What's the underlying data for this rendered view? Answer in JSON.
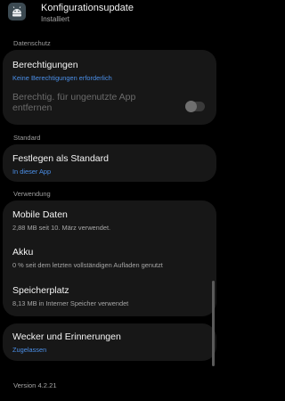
{
  "header": {
    "app_name": "Konfigurationsupdate",
    "status": "Installiert",
    "icon": "android-icon"
  },
  "sections": {
    "datenschutz": "Datenschutz",
    "standard": "Standard",
    "verwendung": "Verwendung"
  },
  "items": {
    "berechtigungen": {
      "title": "Berechtigungen",
      "subtitle": "Keine Berechtigungen erforderlich"
    },
    "unused_permissions": {
      "title": "Berechtig. für ungenutzte App entfernen",
      "toggle_on": false
    },
    "standard": {
      "title": "Festlegen als Standard",
      "subtitle": "In dieser App"
    },
    "mobile_daten": {
      "title": "Mobile Daten",
      "subtitle": "2,88 MB seit 10. März verwendet."
    },
    "akku": {
      "title": "Akku",
      "subtitle": "0 % seit dem letzten vollständigen Aufladen genutzt"
    },
    "speicherplatz": {
      "title": "Speicherplatz",
      "subtitle": "8,13 MB in Interner Speicher verwendet"
    },
    "wecker": {
      "title": "Wecker und Erinnerungen",
      "subtitle": "Zugelassen"
    }
  },
  "footer": {
    "version": "Version 4.2.21"
  },
  "colors": {
    "background": "#000000",
    "card": "#171717",
    "accent": "#4b8fe8",
    "secondary_text": "#a6a6a6",
    "disabled_text": "#6b6b6b"
  }
}
